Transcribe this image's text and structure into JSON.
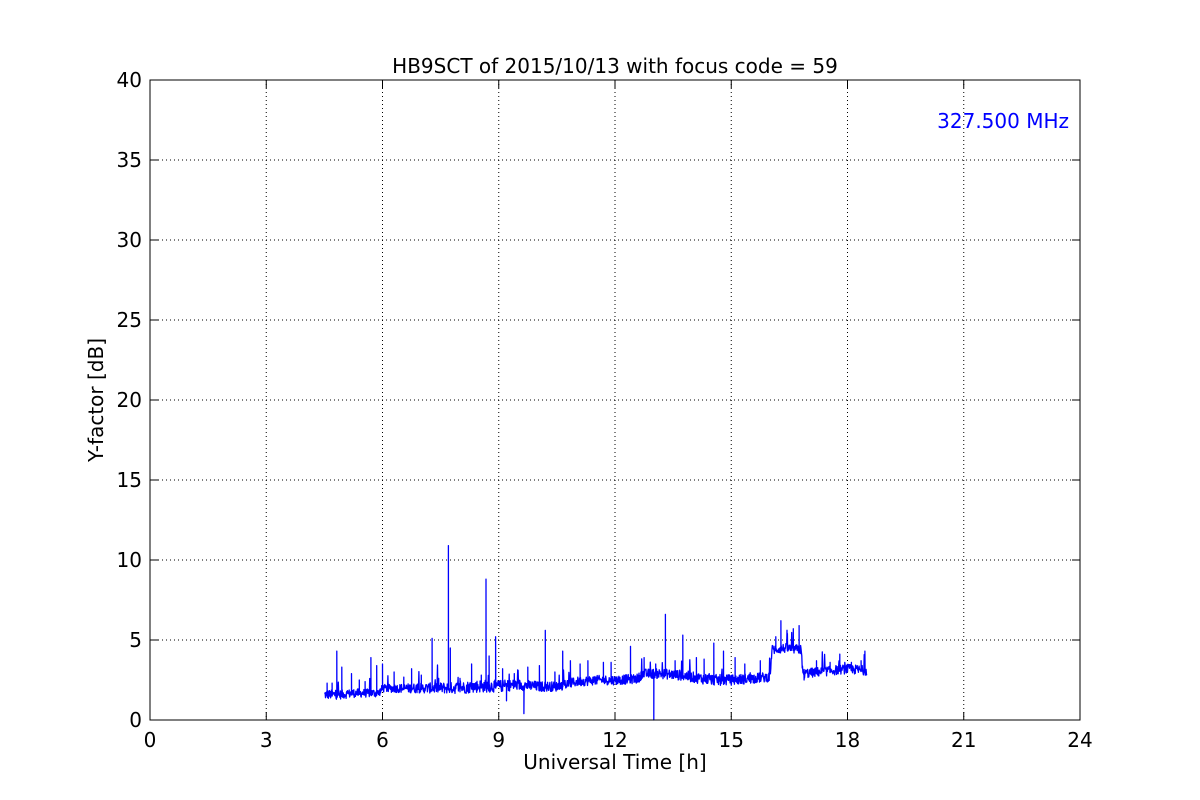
{
  "chart_data": {
    "type": "line",
    "title": "HB9SCT of 2015/10/13 with focus code = 59",
    "xlabel": "Universal Time [h]",
    "ylabel": "Y-factor [dB]",
    "xlim": [
      0,
      24
    ],
    "ylim": [
      0,
      40
    ],
    "xticks": [
      0,
      3,
      6,
      9,
      12,
      15,
      18,
      21,
      24
    ],
    "yticks": [
      0,
      5,
      10,
      15,
      20,
      25,
      30,
      35,
      40
    ],
    "xtick_labels": [
      "0",
      "3",
      "6",
      "9",
      "12",
      "15",
      "18",
      "21",
      "24"
    ],
    "ytick_labels": [
      "0",
      "5",
      "10",
      "15",
      "20",
      "25",
      "30",
      "35",
      "40"
    ],
    "grid": true,
    "grid_style": "dotted",
    "series_color": "#0000ff",
    "annotation": {
      "text": "327.500 MHz",
      "color": "#0000ff",
      "placement": "top-right"
    },
    "series": [
      {
        "baseline": [
          [
            4.5,
            1.5
          ],
          [
            4.9,
            1.5
          ],
          [
            5.3,
            1.6
          ],
          [
            5.6,
            1.6
          ],
          [
            5.9,
            1.6
          ],
          [
            6.0,
            1.9
          ],
          [
            6.5,
            1.9
          ],
          [
            7.0,
            1.9
          ],
          [
            7.5,
            1.9
          ],
          [
            8.0,
            1.9
          ],
          [
            8.5,
            2.0
          ],
          [
            9.0,
            2.0
          ],
          [
            9.5,
            2.1
          ],
          [
            10.0,
            2.0
          ],
          [
            10.5,
            2.0
          ],
          [
            11.0,
            2.3
          ],
          [
            11.5,
            2.4
          ],
          [
            12.0,
            2.4
          ],
          [
            12.6,
            2.5
          ],
          [
            12.7,
            2.8
          ],
          [
            13.2,
            2.8
          ],
          [
            13.7,
            2.7
          ],
          [
            14.2,
            2.5
          ],
          [
            14.6,
            2.4
          ],
          [
            15.0,
            2.4
          ],
          [
            15.5,
            2.5
          ],
          [
            16.0,
            2.6
          ],
          [
            16.05,
            4.3
          ],
          [
            16.4,
            4.4
          ],
          [
            16.8,
            4.3
          ],
          [
            16.85,
            2.8
          ],
          [
            17.2,
            2.9
          ],
          [
            17.6,
            3.0
          ],
          [
            18.0,
            3.1
          ],
          [
            18.5,
            3.0
          ]
        ],
        "noise": [
          [
            4.5,
            0.3
          ],
          [
            6.0,
            0.25
          ],
          [
            8.5,
            0.4
          ],
          [
            10.5,
            0.3
          ],
          [
            12.7,
            0.3
          ],
          [
            14.5,
            0.35
          ],
          [
            16.05,
            0.3
          ],
          [
            16.85,
            0.3
          ],
          [
            18.5,
            0.3
          ]
        ],
        "spikes": [
          [
            4.57,
            2.3
          ],
          [
            4.7,
            2.3
          ],
          [
            4.82,
            4.3
          ],
          [
            4.95,
            3.3
          ],
          [
            5.2,
            2.9
          ],
          [
            5.4,
            2.5
          ],
          [
            5.55,
            2.4
          ],
          [
            5.7,
            3.9
          ],
          [
            5.85,
            3.4
          ],
          [
            6.0,
            3.5
          ],
          [
            6.3,
            3.0
          ],
          [
            6.55,
            2.6
          ],
          [
            6.75,
            3.2
          ],
          [
            7.0,
            2.8
          ],
          [
            7.28,
            5.1
          ],
          [
            7.45,
            2.6
          ],
          [
            7.7,
            10.9
          ],
          [
            7.75,
            4.5
          ],
          [
            8.0,
            2.6
          ],
          [
            8.3,
            3.5
          ],
          [
            8.55,
            2.8
          ],
          [
            8.67,
            8.8
          ],
          [
            8.75,
            4.0
          ],
          [
            8.92,
            5.2
          ],
          [
            9.1,
            3.2
          ],
          [
            9.4,
            2.9
          ],
          [
            9.75,
            3.3
          ],
          [
            10.05,
            3.4
          ],
          [
            10.2,
            5.6
          ],
          [
            10.45,
            3.0
          ],
          [
            10.65,
            4.3
          ],
          [
            10.85,
            3.7
          ],
          [
            11.1,
            3.5
          ],
          [
            11.3,
            3.7
          ],
          [
            11.7,
            3.6
          ],
          [
            11.9,
            3.6
          ],
          [
            12.4,
            4.6
          ],
          [
            12.75,
            3.9
          ],
          [
            13.05,
            3.5
          ],
          [
            13.3,
            6.6
          ],
          [
            13.55,
            3.7
          ],
          [
            13.75,
            5.3
          ],
          [
            14.1,
            3.9
          ],
          [
            14.3,
            3.8
          ],
          [
            14.55,
            4.8
          ],
          [
            14.8,
            4.3
          ],
          [
            15.1,
            3.9
          ],
          [
            15.35,
            3.5
          ],
          [
            15.75,
            3.7
          ],
          [
            16.15,
            5.2
          ],
          [
            16.28,
            6.2
          ],
          [
            16.45,
            5.4
          ],
          [
            16.6,
            5.7
          ],
          [
            16.75,
            5.9
          ],
          [
            17.2,
            3.7
          ],
          [
            17.55,
            3.6
          ],
          [
            17.8,
            3.8
          ],
          [
            18.1,
            3.6
          ],
          [
            18.35,
            3.7
          ],
          [
            18.45,
            4.3
          ]
        ],
        "dips": [
          [
            9.65,
            0.4
          ],
          [
            13.0,
            0.0
          ],
          [
            9.2,
            1.2
          ],
          [
            16.88,
            2.5
          ]
        ]
      }
    ]
  }
}
